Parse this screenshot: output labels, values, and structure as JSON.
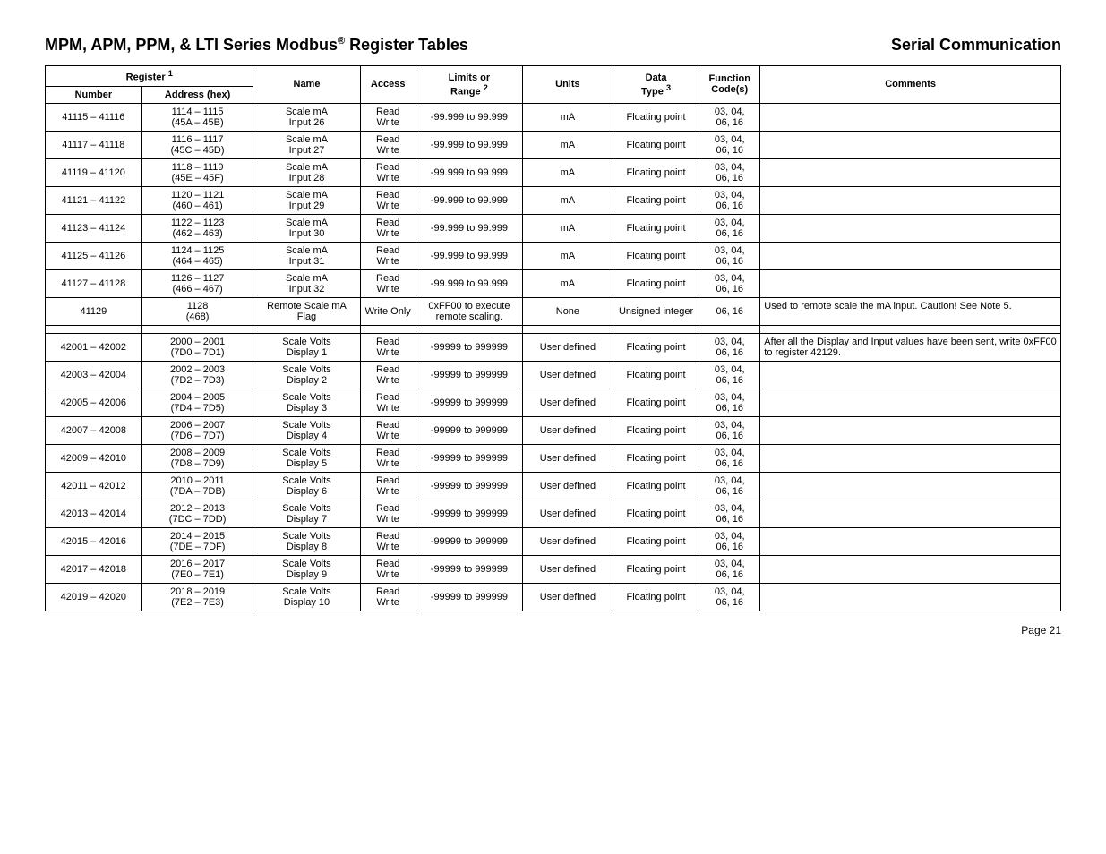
{
  "header": {
    "left_prefix": "MPM, APM, PPM, & LTI Series Modbus",
    "reg_mark": "®",
    "left_suffix": " Register Tables",
    "right": "Serial Communication"
  },
  "columns": {
    "register_group": "Register ",
    "register_sup": "1",
    "number": "Number",
    "address": "Address (hex)",
    "name": "Name",
    "access": "Access",
    "range_l1": "Limits or",
    "range_l2": "Range ",
    "range_sup": "2",
    "units": "Units",
    "data_l1": "Data",
    "data_l2": "Type ",
    "data_sup": "3",
    "func_l1": "Function",
    "func_l2": "Code(s)",
    "comments": "Comments"
  },
  "rows": [
    {
      "num": "41115 – 41116",
      "addr_l1": "1114 – 1115",
      "addr_l2": "(45A – 45B)",
      "name_l1": "Scale mA",
      "name_l2": "Input 26",
      "acc": "Read Write",
      "rng": "-99.999 to 99.999",
      "units": "mA",
      "dt": "Floating point",
      "fc_l1": "03, 04,",
      "fc_l2": "06, 16",
      "com": ""
    },
    {
      "num": "41117 – 41118",
      "addr_l1": "1116 – 1117",
      "addr_l2": "(45C – 45D)",
      "name_l1": "Scale mA",
      "name_l2": "Input 27",
      "acc": "Read Write",
      "rng": "-99.999 to 99.999",
      "units": "mA",
      "dt": "Floating point",
      "fc_l1": "03, 04,",
      "fc_l2": "06, 16",
      "com": ""
    },
    {
      "num": "41119 – 41120",
      "addr_l1": "1118 – 1119",
      "addr_l2": "(45E – 45F)",
      "name_l1": "Scale mA",
      "name_l2": "Input 28",
      "acc": "Read Write",
      "rng": "-99.999 to 99.999",
      "units": "mA",
      "dt": "Floating point",
      "fc_l1": "03, 04,",
      "fc_l2": "06, 16",
      "com": ""
    },
    {
      "num": "41121 – 41122",
      "addr_l1": "1120 – 1121",
      "addr_l2": "(460 – 461)",
      "name_l1": "Scale mA",
      "name_l2": "Input 29",
      "acc": "Read Write",
      "rng": "-99.999 to 99.999",
      "units": "mA",
      "dt": "Floating point",
      "fc_l1": "03, 04,",
      "fc_l2": "06, 16",
      "com": ""
    },
    {
      "num": "41123 – 41124",
      "addr_l1": "1122 – 1123",
      "addr_l2": "(462 – 463)",
      "name_l1": "Scale mA",
      "name_l2": "Input 30",
      "acc": "Read Write",
      "rng": "-99.999 to 99.999",
      "units": "mA",
      "dt": "Floating point",
      "fc_l1": "03, 04,",
      "fc_l2": "06, 16",
      "com": ""
    },
    {
      "num": "41125 – 41126",
      "addr_l1": "1124 – 1125",
      "addr_l2": "(464 – 465)",
      "name_l1": "Scale mA",
      "name_l2": "Input 31",
      "acc": "Read Write",
      "rng": "-99.999 to 99.999",
      "units": "mA",
      "dt": "Floating point",
      "fc_l1": "03, 04,",
      "fc_l2": "06, 16",
      "com": ""
    },
    {
      "num": "41127 – 41128",
      "addr_l1": "1126 – 1127",
      "addr_l2": "(466 – 467)",
      "name_l1": "Scale mA",
      "name_l2": "Input 32",
      "acc": "Read Write",
      "rng": "-99.999 to 99.999",
      "units": "mA",
      "dt": "Floating point",
      "fc_l1": "03, 04,",
      "fc_l2": "06, 16",
      "com": ""
    },
    {
      "num": "41129",
      "addr_l1": "1128",
      "addr_l2": "(468)",
      "name_l1": "Remote Scale mA",
      "name_l2": "Flag",
      "acc": "Write Only",
      "rng": "0xFF00 to execute remote scaling.",
      "units": "None",
      "dt": "Unsigned integer",
      "fc_l1": "06, 16",
      "fc_l2": "",
      "com": "Used to remote scale the mA input. Caution! See Note 5."
    },
    {
      "spacer": true
    },
    {
      "num": "42001 – 42002",
      "addr_l1": "2000 – 2001",
      "addr_l2": "(7D0 – 7D1)",
      "name_l1": "Scale Volts",
      "name_l2": "Display 1",
      "acc": "Read Write",
      "rng": "-99999 to 999999",
      "units": "User defined",
      "dt": "Floating point",
      "fc_l1": "03, 04,",
      "fc_l2": "06, 16",
      "com": "After all the Display and Input values have been sent, write 0xFF00 to register 42129."
    },
    {
      "num": "42003 – 42004",
      "addr_l1": "2002 – 2003",
      "addr_l2": "(7D2 – 7D3)",
      "name_l1": "Scale Volts",
      "name_l2": "Display 2",
      "acc": "Read Write",
      "rng": "-99999 to 999999",
      "units": "User defined",
      "dt": "Floating point",
      "fc_l1": "03, 04,",
      "fc_l2": "06, 16",
      "com": ""
    },
    {
      "num": "42005 – 42006",
      "addr_l1": "2004 – 2005",
      "addr_l2": "(7D4 – 7D5)",
      "name_l1": "Scale Volts",
      "name_l2": "Display 3",
      "acc": "Read Write",
      "rng": "-99999 to 999999",
      "units": "User defined",
      "dt": "Floating point",
      "fc_l1": "03, 04,",
      "fc_l2": "06, 16",
      "com": ""
    },
    {
      "num": "42007 – 42008",
      "addr_l1": "2006 – 2007",
      "addr_l2": "(7D6 – 7D7)",
      "name_l1": "Scale Volts",
      "name_l2": "Display 4",
      "acc": "Read Write",
      "rng": "-99999 to 999999",
      "units": "User defined",
      "dt": "Floating point",
      "fc_l1": "03, 04,",
      "fc_l2": "06, 16",
      "com": ""
    },
    {
      "num": "42009 – 42010",
      "addr_l1": "2008 – 2009",
      "addr_l2": "(7D8 – 7D9)",
      "name_l1": "Scale Volts",
      "name_l2": "Display 5",
      "acc": "Read Write",
      "rng": "-99999 to 999999",
      "units": "User defined",
      "dt": "Floating point",
      "fc_l1": "03, 04,",
      "fc_l2": "06, 16",
      "com": ""
    },
    {
      "num": "42011 – 42012",
      "addr_l1": "2010 – 2011",
      "addr_l2": "(7DA – 7DB)",
      "name_l1": "Scale Volts",
      "name_l2": "Display 6",
      "acc": "Read Write",
      "rng": "-99999 to 999999",
      "units": "User defined",
      "dt": "Floating point",
      "fc_l1": "03, 04,",
      "fc_l2": "06, 16",
      "com": ""
    },
    {
      "num": "42013 – 42014",
      "addr_l1": "2012 – 2013",
      "addr_l2": "(7DC – 7DD)",
      "name_l1": "Scale Volts",
      "name_l2": "Display 7",
      "acc": "Read Write",
      "rng": "-99999 to 999999",
      "units": "User defined",
      "dt": "Floating point",
      "fc_l1": "03, 04,",
      "fc_l2": "06, 16",
      "com": ""
    },
    {
      "num": "42015 – 42016",
      "addr_l1": "2014 – 2015",
      "addr_l2": "(7DE – 7DF)",
      "name_l1": "Scale Volts",
      "name_l2": "Display 8",
      "acc": "Read Write",
      "rng": "-99999 to 999999",
      "units": "User defined",
      "dt": "Floating point",
      "fc_l1": "03, 04,",
      "fc_l2": "06, 16",
      "com": ""
    },
    {
      "num": "42017 – 42018",
      "addr_l1": "2016 – 2017",
      "addr_l2": "(7E0 – 7E1)",
      "name_l1": "Scale Volts",
      "name_l2": "Display 9",
      "acc": "Read Write",
      "rng": "-99999 to 999999",
      "units": "User defined",
      "dt": "Floating point",
      "fc_l1": "03, 04,",
      "fc_l2": "06, 16",
      "com": ""
    },
    {
      "num": "42019 – 42020",
      "addr_l1": "2018 – 2019",
      "addr_l2": "(7E2 – 7E3)",
      "name_l1": "Scale Volts",
      "name_l2": "Display 10",
      "acc": "Read Write",
      "rng": "-99999 to 999999",
      "units": "User defined",
      "dt": "Floating point",
      "fc_l1": "03, 04,",
      "fc_l2": "06, 16",
      "com": ""
    }
  ],
  "footer": "Page 21"
}
